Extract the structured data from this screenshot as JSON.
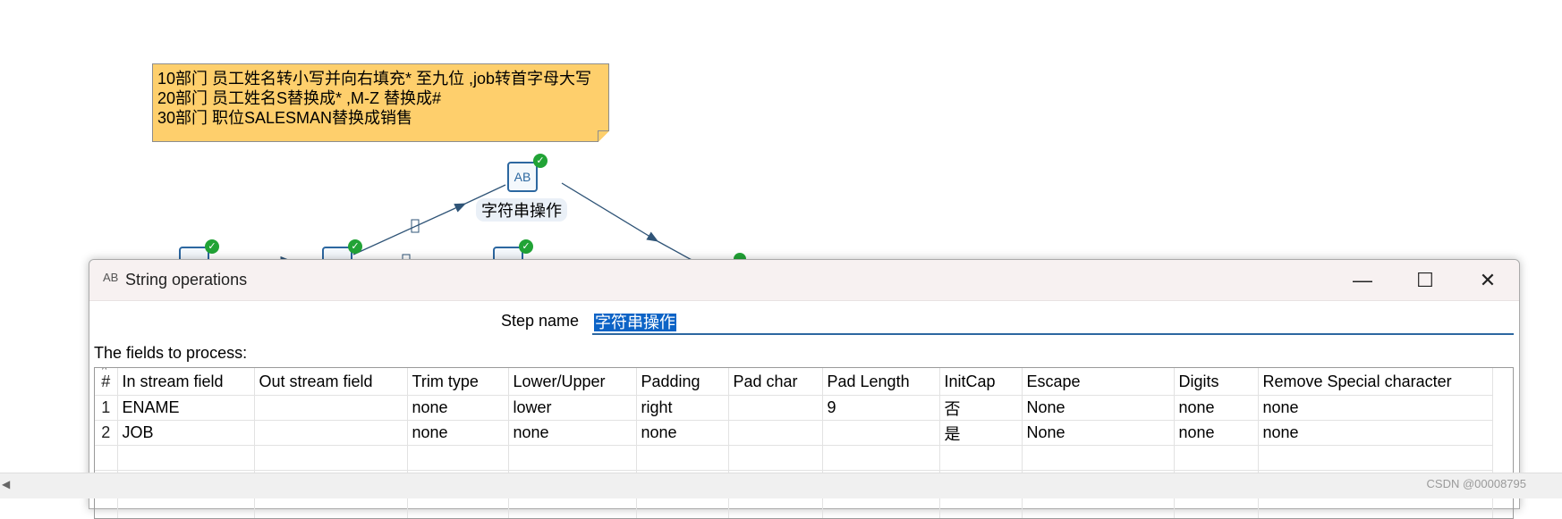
{
  "note": {
    "lines": [
      "10部门 员工姓名转小写并向右填充* 至九位 ,job转首字母大写",
      "20部门 员工姓名S替换成* ,M-Z 替换成#",
      "30部门 职位SALESMAN替换成销售"
    ]
  },
  "canvas": {
    "step_label": "字符串操作",
    "step_icon_text": "AB"
  },
  "dialog": {
    "title": "String operations",
    "title_icon_text": "AB",
    "window_buttons": {
      "minimize": "—",
      "maximize": "☐",
      "close": "✕"
    },
    "step_name_label": "Step name",
    "step_name_value": "字符串操作",
    "fields_label": "The fields to process:",
    "columns": [
      "#",
      "In stream field",
      "Out stream field",
      "Trim type",
      "Lower/Upper",
      "Padding",
      "Pad char",
      "Pad Length",
      "InitCap",
      "Escape",
      "Digits",
      "Remove Special character"
    ],
    "rows": [
      [
        "1",
        "ENAME",
        "",
        "none",
        "lower",
        "right",
        "",
        "9",
        "否",
        "None",
        "none",
        "none"
      ],
      [
        "2",
        "JOB",
        "",
        "none",
        "none",
        "none",
        "",
        "",
        "是",
        "None",
        "none",
        "none"
      ]
    ]
  },
  "watermark": "CSDN @00008795"
}
